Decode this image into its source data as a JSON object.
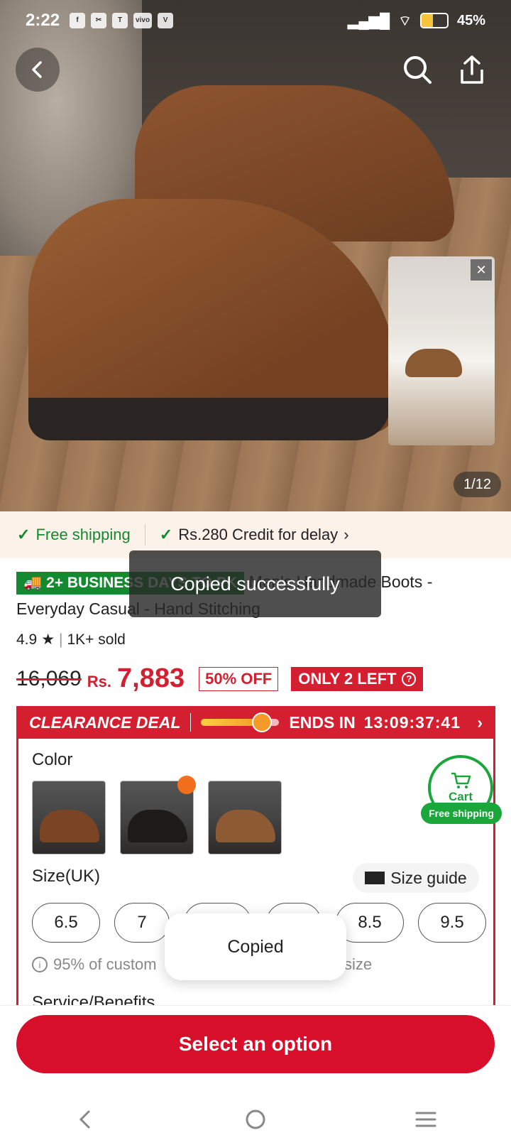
{
  "status_bar": {
    "time": "2:22",
    "left_icons": [
      "facebook-icon",
      "scissors-icon",
      "temu-icon",
      "vivo-icon",
      "v-app-icon"
    ],
    "network": "4G",
    "battery_percent": "45%",
    "battery_level": 0.45
  },
  "gallery": {
    "counter": "1/12"
  },
  "shipping": {
    "free_shipping": "Free shipping",
    "credit": "Rs.280 Credit for delay"
  },
  "product": {
    "badge": "2+ BUSINESS DAYS TO PK",
    "title": "Men's Handmade Boots - Everyday Casual - Hand Stitching",
    "rating": "4.9",
    "sold": "1K+ sold",
    "old_price": "16,069",
    "currency": "Rs.",
    "price": "7,883",
    "discount": "50% OFF",
    "stock": "ONLY 2 LEFT"
  },
  "deal": {
    "title": "CLEARANCE DEAL",
    "ends_label": "ENDS IN",
    "timer": "13:09:37:41",
    "progress": 0.78
  },
  "options": {
    "color_label": "Color",
    "size_label": "Size(UK)",
    "size_guide": "Size guide",
    "sizes": [
      "6.5",
      "7",
      "8",
      "8",
      "8.5",
      "9.5"
    ],
    "hint": "95% of customers say these fit true to size",
    "hint_visible_start": "95% of custom",
    "hint_visible_end": "size",
    "services": "Service/Benefits"
  },
  "cart": {
    "label": "Cart",
    "pill": "Free shipping"
  },
  "cta": {
    "label": "Select an option"
  },
  "toasts": {
    "dark": "Copied successfully",
    "light": "Copied"
  },
  "colors": {
    "accent_red": "#d41f31",
    "cta_red": "#d80f2a",
    "green": "#138a2f"
  }
}
